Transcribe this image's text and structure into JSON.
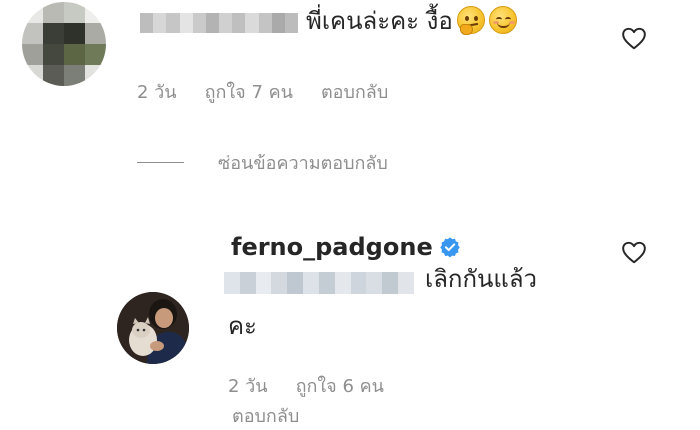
{
  "comment1": {
    "text": "พี่เคนล่ะคะ งื้อ",
    "emojis": [
      "thinking-face",
      "smiling-face"
    ],
    "time": "2 วัน",
    "likes": "ถูกใจ 7 คน",
    "reply_label": "ตอบกลับ"
  },
  "hide_replies_label": "ซ่อนข้อความตอบกลับ",
  "reply": {
    "username": "ferno_padgone",
    "text_line1": "เลิกกันแล้ว",
    "text_line2": "คะ",
    "time": "2 วัน",
    "likes": "ถูกใจ 6 คน",
    "reply_label": "ตอบกลับ"
  },
  "colors": {
    "text": "#262626",
    "secondary": "#8e8e8e",
    "verified": "#3897f0"
  }
}
